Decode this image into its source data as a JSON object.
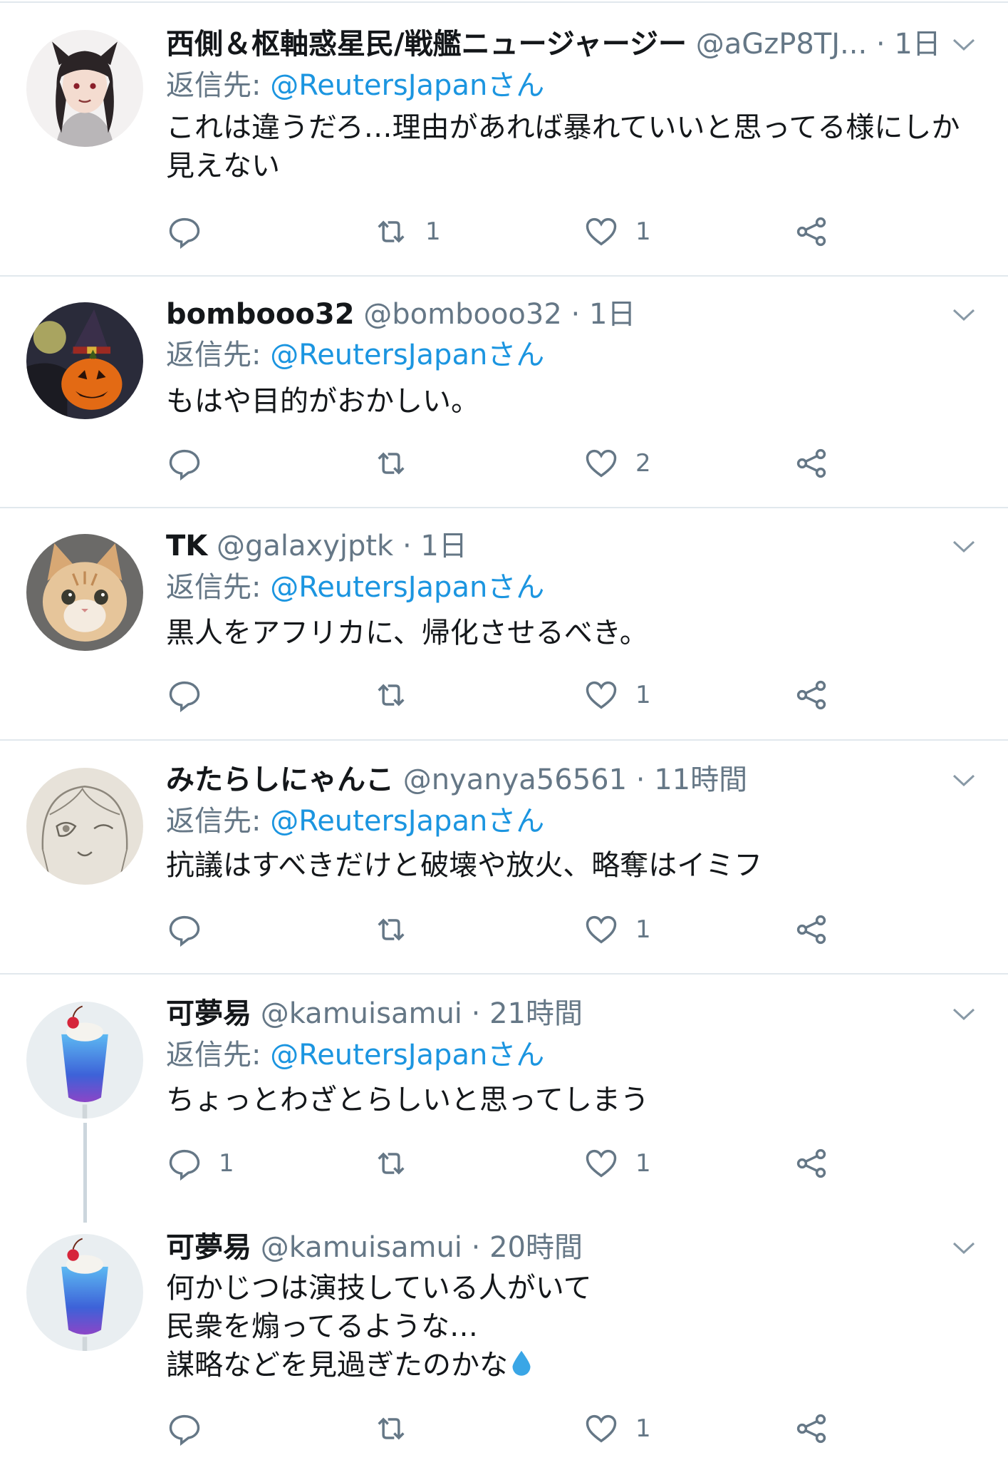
{
  "tweets": [
    {
      "name": "西側＆枢軸惑星民/戦艦ニュージャージー",
      "handle": "@aGzP8TJ...",
      "time": "1日",
      "reply_to_prefix": "返信先: ",
      "reply_to_mention": "@ReutersJapanさん",
      "text_lines": [
        "これは違うだろ…理由があれば暴れていいと思ってる様にしか",
        "見えない"
      ],
      "reply_count": "",
      "retweet_count": "1",
      "like_count": "1"
    },
    {
      "name": "bombooo32",
      "handle": "@bombooo32",
      "time": "1日",
      "reply_to_prefix": "返信先: ",
      "reply_to_mention": "@ReutersJapanさん",
      "text_lines": [
        "もはや目的がおかしい。"
      ],
      "reply_count": "",
      "retweet_count": "",
      "like_count": "2"
    },
    {
      "name": "TK",
      "handle": "@galaxyjptk",
      "time": "1日",
      "reply_to_prefix": "返信先: ",
      "reply_to_mention": "@ReutersJapanさん",
      "text_lines": [
        "黒人をアフリカに、帰化させるべき。"
      ],
      "reply_count": "",
      "retweet_count": "",
      "like_count": "1"
    },
    {
      "name": "みたらしにゃんこ",
      "handle": "@nyanya56561",
      "time": "11時間",
      "reply_to_prefix": "返信先: ",
      "reply_to_mention": "@ReutersJapanさん",
      "text_lines": [
        "抗議はすべきだけと破壊や放火、略奪はイミフ"
      ],
      "reply_count": "",
      "retweet_count": "",
      "like_count": "1"
    },
    {
      "name": "可夢易",
      "handle": "@kamuisamui",
      "time": "21時間",
      "reply_to_prefix": "返信先: ",
      "reply_to_mention": "@ReutersJapanさん",
      "text_lines": [
        "ちょっとわざとらしいと思ってしまう"
      ],
      "reply_count": "1",
      "retweet_count": "",
      "like_count": "1"
    },
    {
      "name": "可夢易",
      "handle": "@kamuisamui",
      "time": "20時間",
      "text_lines": [
        "何かじつは演技している人がいて",
        "民衆を煽ってるような…",
        "謀略などを見過ぎたのかな"
      ],
      "reply_count": "",
      "retweet_count": "",
      "like_count": "1"
    }
  ],
  "separator": " · ",
  "icons": [
    "reply-icon",
    "retweet-icon",
    "like-icon",
    "share-icon",
    "chevron-down-icon",
    "droplet-icon"
  ],
  "colors": {
    "link": "#1b95e0",
    "muted": "#657786",
    "divider": "#e1e8ed"
  }
}
